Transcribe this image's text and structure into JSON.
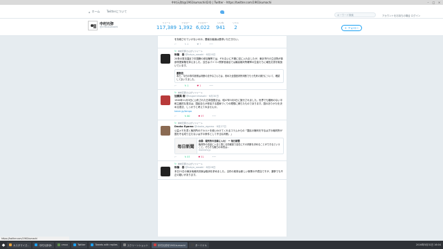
{
  "window": {
    "title": "中村元弥(@1961kumachi424) | Twitter - https://twitter.com/1961kumachi"
  },
  "nav": {
    "home": "ホーム",
    "about": "Twitterについて",
    "search_placeholder": "キーワード検索",
    "login": "アカウントをお持ちの場合 ログイン"
  },
  "profile": {
    "name": "中村元弥",
    "handle": "@1961kumachi",
    "stats": [
      {
        "label": "ツイート",
        "value": "117,389"
      },
      {
        "label": "フォロー",
        "value": "1,392"
      },
      {
        "label": "フォロワー",
        "value": "6,022"
      },
      {
        "label": "いいね",
        "value": "941"
      },
      {
        "label": "リスト",
        "value": "2"
      }
    ],
    "follow": "フォロー"
  },
  "tweets": [
    {
      "rt": "",
      "name": "",
      "handle": "",
      "date": "",
      "text": "を存続させていけないのか。要議な議論は要求いただきたい。",
      "actions": [
        "",
        "↻ 4",
        "♥ 7"
      ],
      "highlight": "none"
    },
    {
      "rt": "中村元弥さんがリツイート",
      "name": "秋篠　基",
      "handle": "@tokyo_sasaki · 6月20日",
      "date": "",
      "text": "20条の憲法違反で中国籍の参加権等では、それないに不服に収に入れましたが、東京市行の立法院が事部専提案権を抑えました。当日はパソコン関係官者店では最高裁判所確率の生徒たちに報告文書を取扱いでいます。",
      "quote_name": "番数佐",
      "quote_text": "本だ。今日の事件参照は判断の法令なさんでは、改めた全国官判所判断でもう先来の実行について、確認してまいりました。",
      "actions": [
        "",
        "↻ 1",
        "♥ 1"
      ],
      "highlight": "none"
    },
    {
      "rt": "中村元弥さんがリツイート",
      "name": "加賀美 樹",
      "handle": "@kagamimasaki · 6月30日",
      "date": "",
      "text": "1946年11月3日に公布された日本国憲法は、昭47年5月3日に施行されました。世界でも類例のない平和主義的な憲法は、国民自らが参加する国家づくりの理想に満ちたものであります。国のありかたを決める憲法、しっかりと考えてみませんか。",
      "link": "kenm.jp/kenpo",
      "actions": [
        "",
        "↻ 80",
        "♥ 37"
      ],
      "highlight": "none"
    },
    {
      "rt": "中村元弥さんがリツイート",
      "name": "Daoko Egamo",
      "handle": "@daoko_egamo · 6月27日",
      "date": "",
      "text": "公益メモを書く裁判所のデカルトを使いわけてくれるコラムからの「国民の権利を守るはずの裁判所が国を守る成り立たないはずの条件として不当な判断。」",
      "card_logo": "毎日新聞",
      "card_title": "余録：裁判所の目線に入れ！ ー 毎日新聞",
      "card_text": "裁判所の法廷に入ると感じる情報量で自在にその判断を決めることができるということ。そもそも権力の本質は...",
      "card_domain": "mainichi.jp",
      "actions": [
        "",
        "↻ 57",
        "♥ 31"
      ],
      "highlight": "none"
    },
    {
      "rt": "中村元弥さんがリツイート",
      "name": "秋篠　基",
      "handle": "@tokyo_sasaki · 6月26日",
      "date": "",
      "text": "本日21日の東京地裁判決案は取消を求めました。当件の政府は新しい事業の不適当ですが、選挙でも不正の疑いがあります。",
      "actions": [],
      "highlight": "none"
    }
  ],
  "statusbar": {
    "url": "https://twitter.com/1961kumachi"
  },
  "taskbar": {
    "tasks": [
      {
        "label": "カスタマイズ...",
        "color": "#e8a33d"
      },
      {
        "label": "中村元弥@t",
        "color": "#1da1f2"
      },
      {
        "label": "cmux",
        "color": "#5f8a4d"
      },
      {
        "label": "Twitter",
        "color": "#1da1f2"
      },
      {
        "label": "Tweets with replies",
        "color": "#1da1f2"
      },
      {
        "label": "スクリーンショット",
        "color": "#888888"
      },
      {
        "label": "中村元弥@1961kumachi",
        "color": "#d04343"
      },
      {
        "label": "ターミナル",
        "color": "#444444"
      }
    ],
    "tray": "2016年5月31日 16:04"
  }
}
